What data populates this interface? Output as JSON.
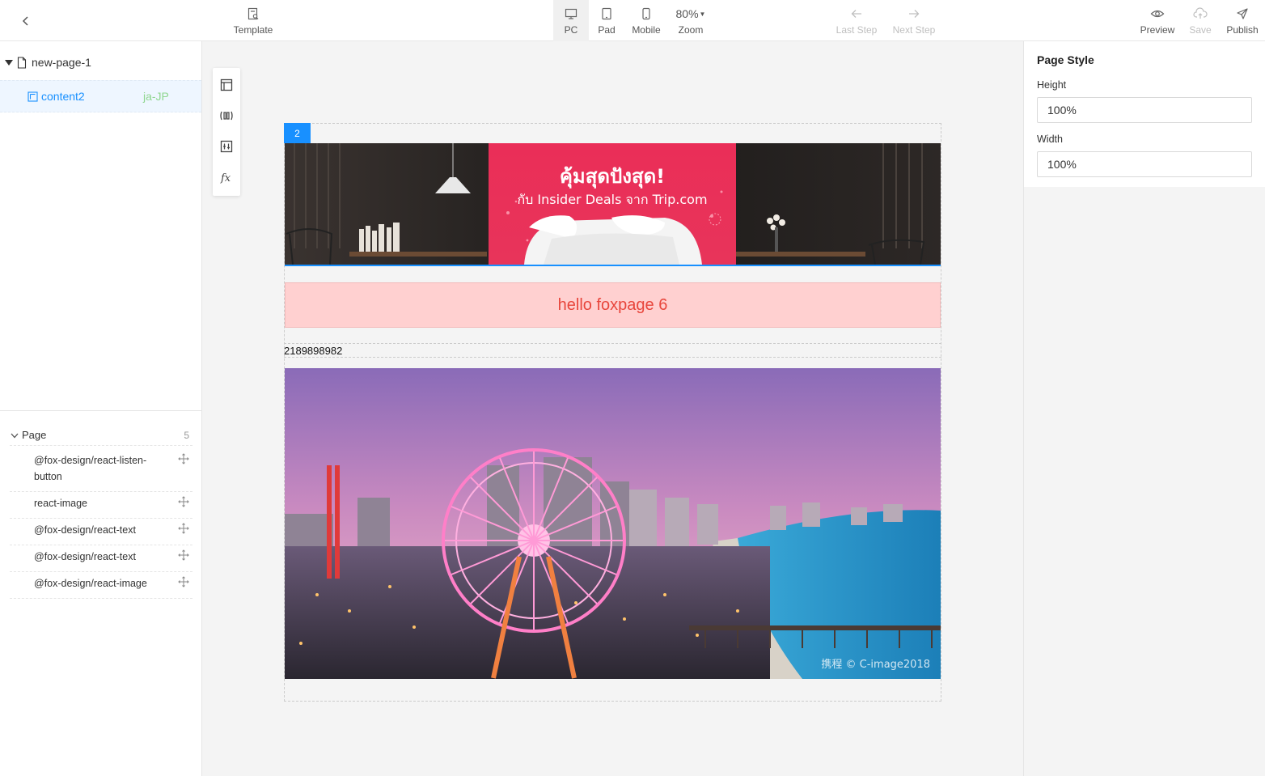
{
  "toolbar": {
    "template_label": "Template",
    "pc_label": "PC",
    "pad_label": "Pad",
    "mobile_label": "Mobile",
    "zoom_value": "80%",
    "zoom_label": "Zoom",
    "last_step_label": "Last Step",
    "next_step_label": "Next Step",
    "preview_label": "Preview",
    "save_label": "Save",
    "publish_label": "Publish",
    "active_device": "PC"
  },
  "tree": {
    "page_name": "new-page-1",
    "content_name": "content2",
    "content_locale": "ja-JP"
  },
  "components": {
    "group_label": "Page",
    "count": "5",
    "items": [
      {
        "label": "@fox-design/react-listen-button"
      },
      {
        "label": "react-image"
      },
      {
        "label": "@fox-design/react-text"
      },
      {
        "label": "@fox-design/react-text"
      },
      {
        "label": "@fox-design/react-image"
      }
    ]
  },
  "canvas": {
    "badge": "2",
    "banner_headline": "คุ้มสุดปังสุด!",
    "banner_subline": "กับ Insider Deals จาก Trip.com",
    "hello_text": "hello foxpage 6",
    "number_text": "2189898982",
    "watermark": "携程 © C-image2018"
  },
  "style_panel": {
    "title": "Page Style",
    "height_label": "Height",
    "height_value": "100%",
    "width_label": "Width",
    "width_value": "100%"
  },
  "colors": {
    "accent": "#1890ff",
    "banner_pink": "#e8345a",
    "hello_bg": "#ffd0d0",
    "hello_text": "#e8463c"
  }
}
